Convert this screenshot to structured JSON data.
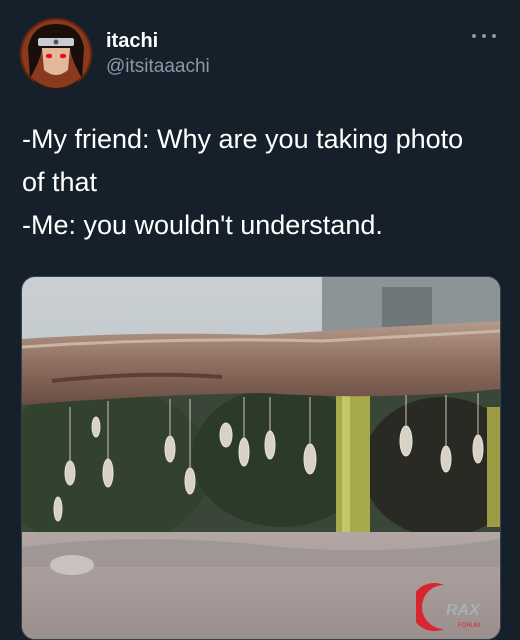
{
  "tweet": {
    "display_name": "itachi",
    "handle": "@itsitaaachi",
    "lines": [
      "-My friend: Why are you taking photo",
      "of that",
      "-Me: you wouldn't understand."
    ],
    "more_icon": "more-horizontal-icon"
  },
  "media": {
    "watermark_text": "RAX",
    "watermark_subtext": "FORUM"
  },
  "colors": {
    "background": "#15202b",
    "secondary_text": "#8b98a5",
    "primary_text": "#ffffff"
  }
}
